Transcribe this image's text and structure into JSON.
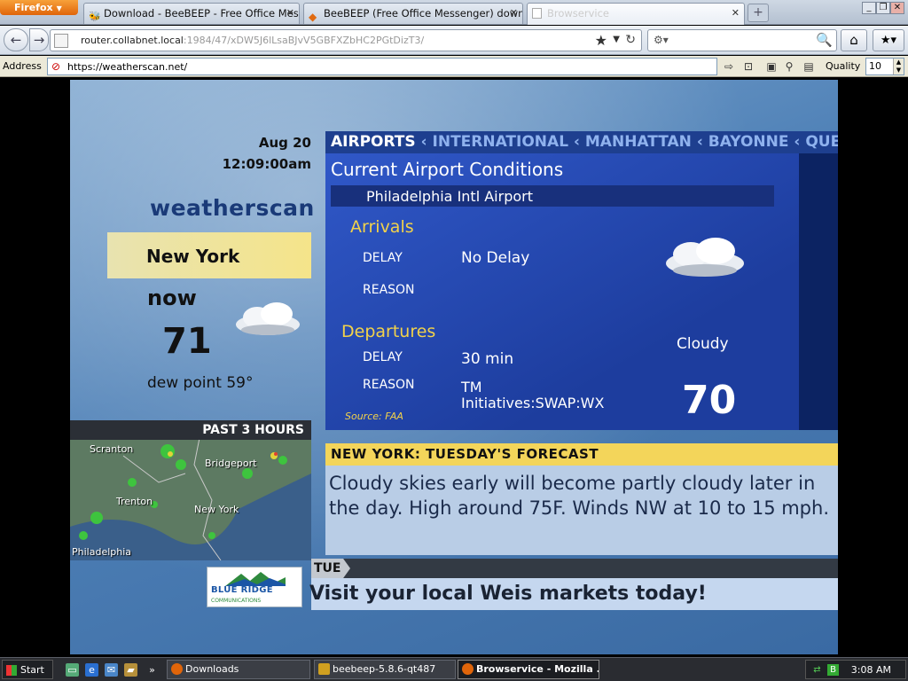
{
  "browser": {
    "menu_button": "Firefox",
    "tabs": [
      {
        "label": "Download - BeeBEEP - Free Office Messe..."
      },
      {
        "label": "BeeBEEP (Free Office Messenger) downl..."
      },
      {
        "label": "Browservice"
      }
    ],
    "url": {
      "host": "router.collabnet.local",
      "rest": ":1984/47/xDW5J6lLsaBJvV5GBFXZbHC2PGtDizT3/"
    },
    "quality_label": "Quality",
    "quality_value": "10",
    "address_label": "Address",
    "address_value": "https://weatherscan.net/"
  },
  "weatherscan": {
    "date": "Aug 20",
    "time": "12:09:00am",
    "brand": "weatherscan",
    "city": "New York",
    "now_label": "now",
    "now_temp": "71",
    "dew_point": "dew point 59°",
    "radar_title": "PAST 3 HOURS",
    "radar_labels": [
      "Scranton",
      "Bridgeport",
      "Trenton",
      "New York",
      "Philadelphia"
    ],
    "airport": {
      "nav": [
        "AIRPORTS",
        "INTERNATIONAL",
        "MANHATTAN",
        "BAYONNE",
        "QUEENS"
      ],
      "title": "Current Airport Conditions",
      "airport_name": "Philadelphia Intl Airport",
      "arrivals_label": "Arrivals",
      "departures_label": "Departures",
      "delay_label": "DELAY",
      "reason_label": "REASON",
      "arrivals_delay": "No Delay",
      "arrivals_reason": "",
      "departures_delay": "30 min",
      "departures_reason_1": "TM",
      "departures_reason_2": "Initiatives:SWAP:WX",
      "source": "Source: FAA",
      "condition": "Cloudy",
      "temp": "70"
    },
    "forecast": {
      "heading": "NEW YORK:   TUESDAY'S FORECAST",
      "text": "Cloudy skies early will become partly cloudy later in the day. High around 75F. Winds NW at 10 to 15 mph."
    },
    "ticker": {
      "tab": "TUE",
      "text": "Visit your local Weis markets today!"
    },
    "sponsor": {
      "line1": "BLUE RIDGE",
      "line2": "COMMUNICATIONS"
    }
  },
  "taskbar": {
    "start": "Start",
    "tasks": [
      {
        "label": "Downloads"
      },
      {
        "label": "beebeep-5.8.6-qt487"
      },
      {
        "label": "Browservice - Mozilla ..."
      }
    ],
    "clock": "3:08 AM"
  }
}
